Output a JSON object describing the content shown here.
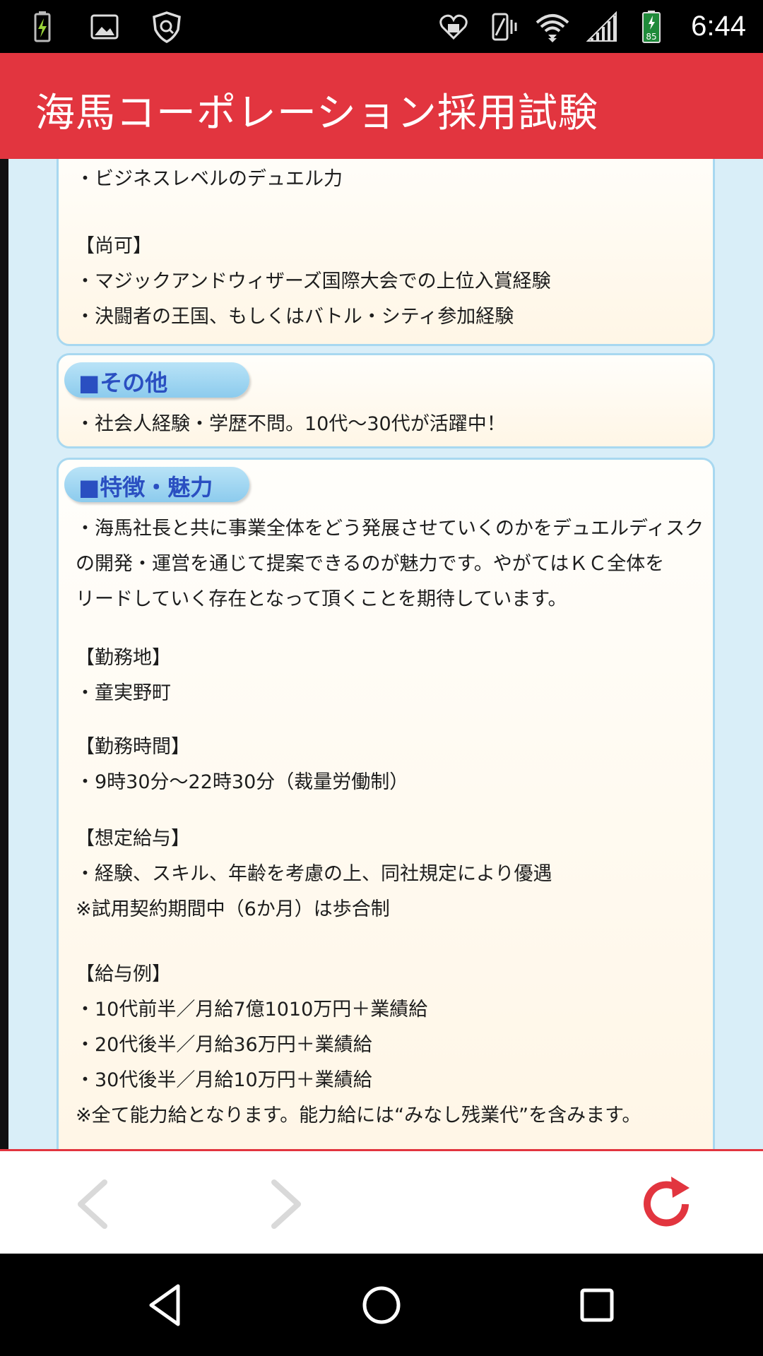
{
  "status_bar": {
    "time": "6:44",
    "battery_level": "85",
    "icons": [
      "battery-charging-icon",
      "image-icon",
      "shield-icon",
      "heart-notification-icon",
      "vibrate-icon",
      "wifi-icon",
      "signal-icon",
      "battery-icon"
    ]
  },
  "app_bar": {
    "title": "海馬コーポレーション採用試験"
  },
  "content": {
    "card_a": {
      "line1": "・ビジネスレベルのデュエル力",
      "heading": "【尚可】",
      "line2": "・マジックアンドウィザーズ国際大会での上位入賞経験",
      "line3": "・決闘者の王国、もしくはバトル・シティ参加経験"
    },
    "card_b": {
      "pill": "■その他",
      "line1": "・社会人経験・学歴不問。10代〜30代が活躍中！"
    },
    "card_c": {
      "pill": "■特徴・魅力",
      "intro1": "・海馬社長と共に事業全体をどう発展させていくのかをデュエルディスク",
      "intro2": "の開発・運営を通じて提案できるのが魅力です。やがてはＫＣ全体を",
      "intro3": "リードしていく存在となって頂くことを期待しています。",
      "location_heading": "【勤務地】",
      "location": "・童実野町",
      "hours_heading": "【勤務時間】",
      "hours": "・9時30分〜22時30分（裁量労働制）",
      "salary_heading": "【想定給与】",
      "salary1": "・経験、スキル、年齢を考慮の上、同社規定により優遇",
      "salary2": "※試用契約期間中（6か月）は歩合制",
      "examples_heading": "【給与例】",
      "example1": "・10代前半／月給7億1010万円＋業績給",
      "example2": "・20代後半／月給36万円＋業績給",
      "example3": "・30代後半／月給10万円＋業績給",
      "note": "※全て能力給となります。能力給には“みなし残業代”を含みます。"
    }
  },
  "colors": {
    "brand_red": "#e2353f",
    "page_bg": "#d9eef8",
    "card_border": "#a8d8f0",
    "pill_text": "#2a4fc1"
  }
}
